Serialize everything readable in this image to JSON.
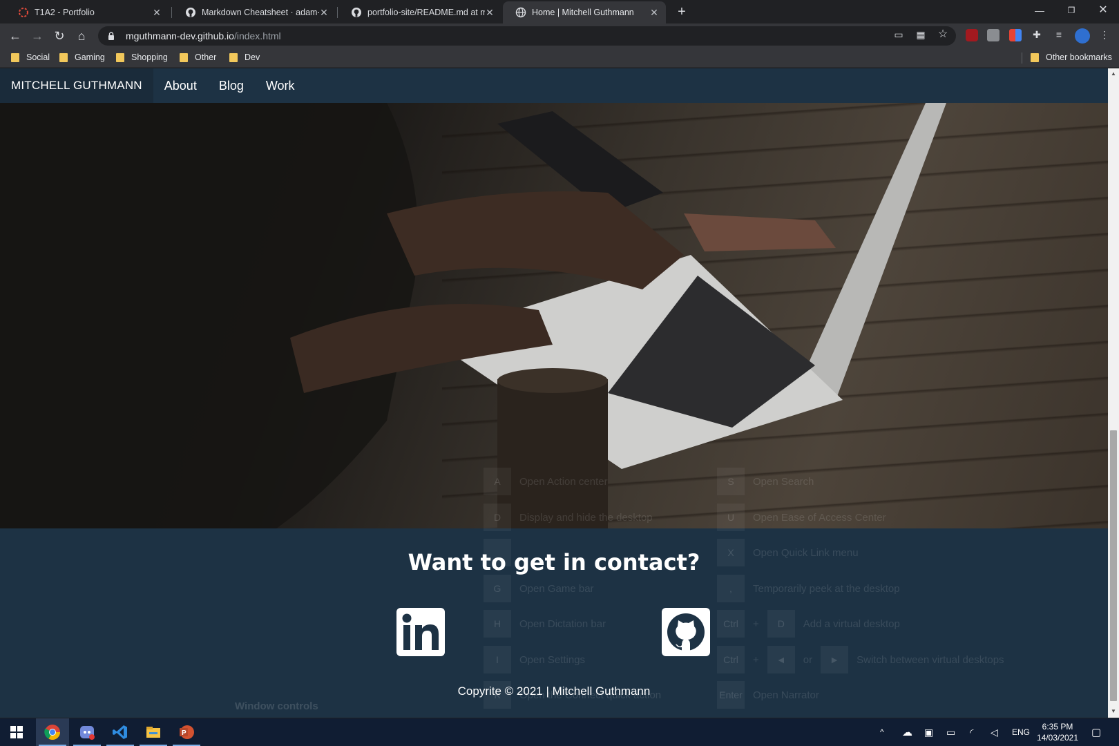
{
  "browser": {
    "tabs": [
      {
        "title": "T1A2 - Portfolio",
        "active": false
      },
      {
        "title": "Markdown Cheatsheet · adam-p/",
        "active": false
      },
      {
        "title": "portfolio-site/README.md at ma",
        "active": false
      },
      {
        "title": "Home | Mitchell Guthmann",
        "active": true
      }
    ],
    "url_host": "mguthmann-dev.github.io",
    "url_path": "/index.html",
    "bookmarks": [
      "Social",
      "Gaming",
      "Shopping",
      "Other",
      "Dev"
    ],
    "other_bookmarks": "Other bookmarks"
  },
  "site": {
    "brand": "MITCHELL GUTHMANN",
    "nav": [
      "About",
      "Blog",
      "Work"
    ],
    "contact_heading": "Want to get in contact?",
    "social": [
      {
        "name": "linkedin",
        "glyph": "in"
      },
      {
        "name": "github",
        "glyph": "github-icon"
      }
    ],
    "copyright": "Copyrite © 2021 | Mitchell Guthmann"
  },
  "overlay": {
    "left_column": [
      {
        "key": "A",
        "label": "Open Action center"
      },
      {
        "key": "D",
        "label": "Display and hide the desktop"
      },
      {
        "key": "",
        "label": ""
      },
      {
        "key": "G",
        "label": "Open Game bar"
      },
      {
        "key": "H",
        "label": "Open Dictation bar"
      },
      {
        "key": "I",
        "label": "Open Settings"
      },
      {
        "key": "K",
        "label": "Open the Connect quick action"
      }
    ],
    "right_column": [
      {
        "key": "S",
        "label": "Open Search"
      },
      {
        "key": "U",
        "label": "Open Ease of Access Center"
      },
      {
        "key": "X",
        "label": "Open Quick Link menu"
      },
      {
        "key": ",",
        "label": "Temporarily peek at the desktop"
      },
      {
        "key": "Ctrl",
        "key2": "D",
        "label": "Add a virtual desktop"
      },
      {
        "key": "Ctrl",
        "key2": "◄",
        "or": "or",
        "key3": "►",
        "label": "Switch between virtual desktops"
      },
      {
        "key": "Enter",
        "label": "Open Narrator"
      }
    ],
    "window_controls_label": "Window controls"
  },
  "taskbar": {
    "language": "ENG",
    "time": "6:35 PM",
    "date": "14/03/2021"
  },
  "colors": {
    "page_bg": "#1d3244",
    "brand_bg": "#1a2b3a",
    "taskbar_bg": "#101d33"
  }
}
